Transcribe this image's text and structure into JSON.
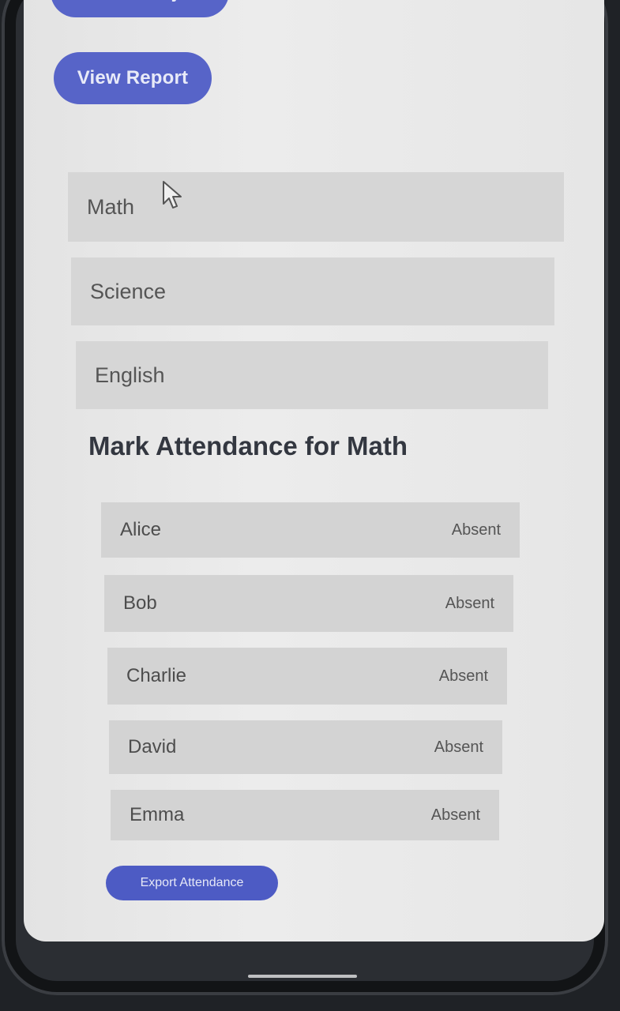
{
  "actions": {
    "select_subject": "Select Subject",
    "view_report": "View Report",
    "export_attendance": "Export Attendance"
  },
  "subjects": [
    {
      "label": "Math"
    },
    {
      "label": "Science"
    },
    {
      "label": "English"
    }
  ],
  "attendance": {
    "title": "Mark Attendance for Math",
    "students": [
      {
        "name": "Alice",
        "status": "Absent"
      },
      {
        "name": "Bob",
        "status": "Absent"
      },
      {
        "name": "Charlie",
        "status": "Absent"
      },
      {
        "name": "David",
        "status": "Absent"
      },
      {
        "name": "Emma",
        "status": "Absent"
      }
    ]
  },
  "colors": {
    "primary": "#5764c8",
    "list_item_bg": "#d6d6d6",
    "screen_bg": "#e8e8e8",
    "title_text": "#333740"
  },
  "icons": {
    "pointer": "mouse-pointer-icon"
  }
}
